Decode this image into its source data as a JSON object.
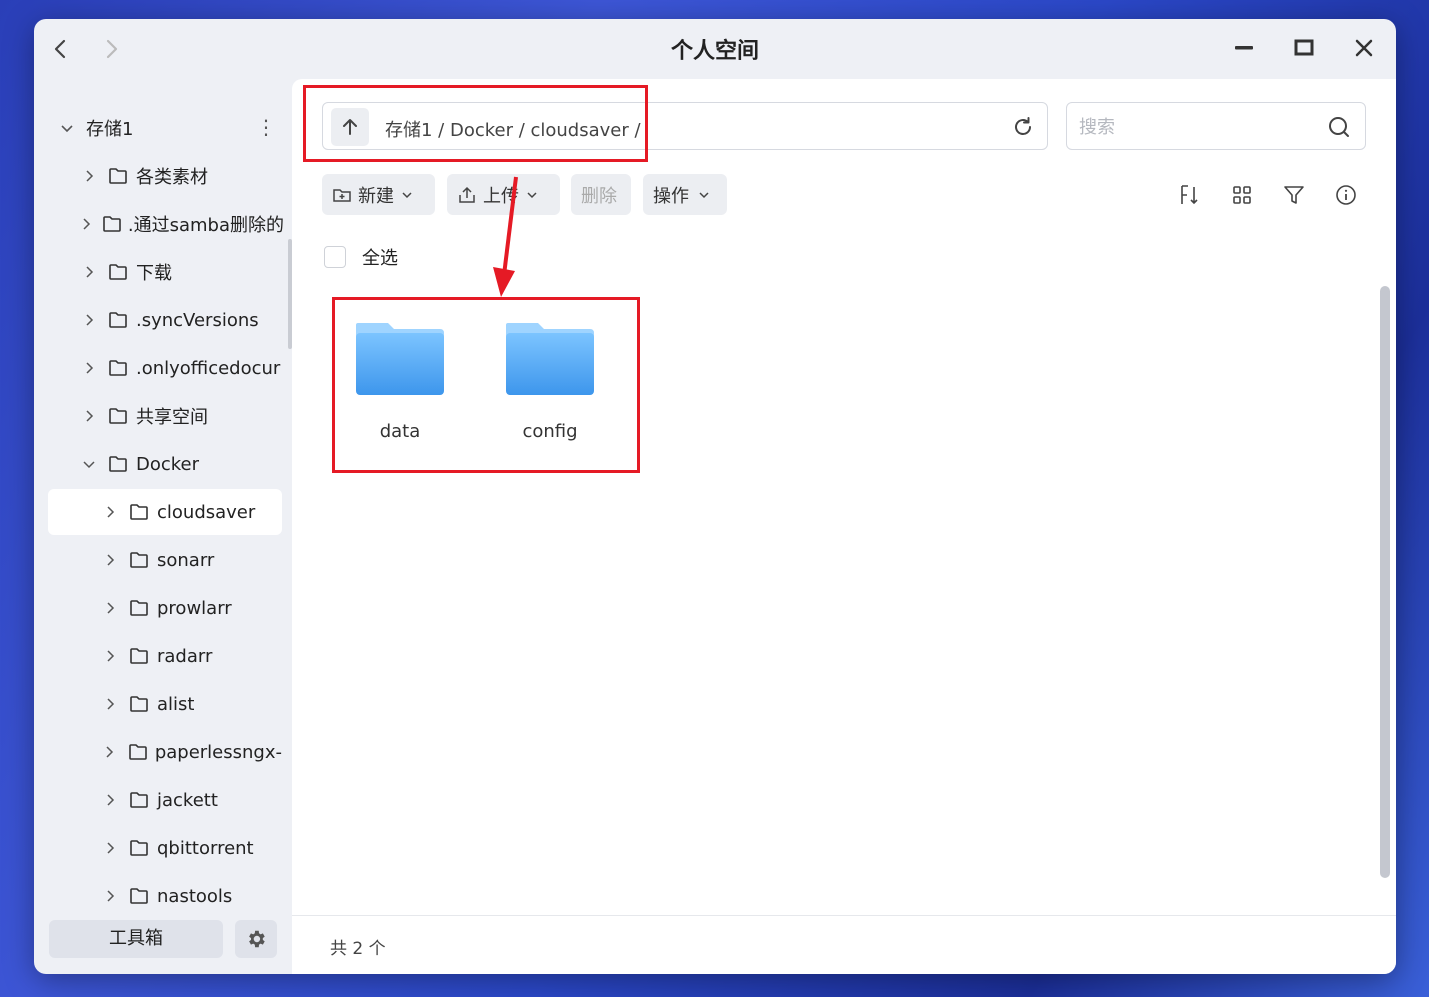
{
  "window": {
    "title": "个人空间",
    "back_icon": "chevron-left-icon",
    "forward_icon": "chevron-right-icon"
  },
  "sidebar": {
    "root": {
      "label": "存储1",
      "expanded": true
    },
    "items": [
      {
        "label": "各类素材"
      },
      {
        "label": ".通过samba删除的"
      },
      {
        "label": "下载"
      },
      {
        "label": ".syncVersions"
      },
      {
        "label": ".onlyofficedocur"
      },
      {
        "label": "共享空间"
      },
      {
        "label": "Docker",
        "expanded": true
      }
    ],
    "docker_children": [
      {
        "label": "cloudsaver",
        "selected": true
      },
      {
        "label": "sonarr"
      },
      {
        "label": "prowlarr"
      },
      {
        "label": "radarr"
      },
      {
        "label": "alist"
      },
      {
        "label": "paperlessngx-"
      },
      {
        "label": "jackett"
      },
      {
        "label": "qbittorrent"
      },
      {
        "label": "nastools"
      }
    ],
    "toolbox_label": "工具箱",
    "settings_icon": "gear-icon"
  },
  "pathbar": {
    "path": "存储1 / Docker / cloudsaver /"
  },
  "search": {
    "placeholder": "搜索"
  },
  "toolbar": {
    "new_label": "新建",
    "upload_label": "上传",
    "delete_label": "删除",
    "action_label": "操作"
  },
  "select_all_label": "全选",
  "files": [
    {
      "name": "data",
      "type": "folder"
    },
    {
      "name": "config",
      "type": "folder"
    }
  ],
  "footer": {
    "count_text": "共 2 个"
  },
  "colors": {
    "annotation": "#e51a25",
    "folder": "#5aaef5",
    "window_bg": "#eef0f5"
  }
}
